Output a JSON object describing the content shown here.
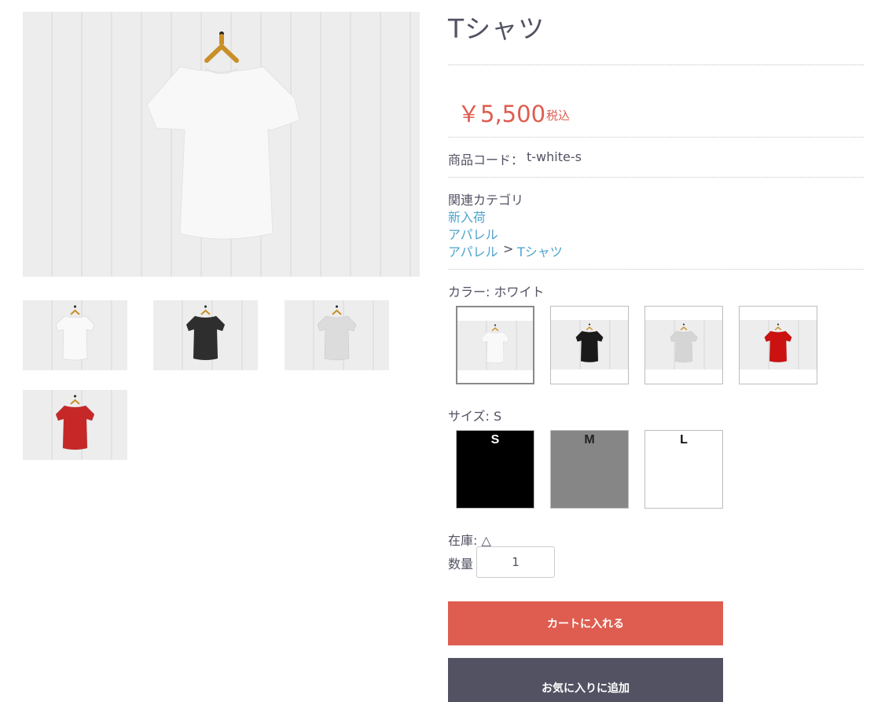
{
  "product": {
    "title": "Tシャツ",
    "price": "￥5,500",
    "tax_label": "税込",
    "code_label": "商品コード：",
    "code_value": "t-white-s"
  },
  "categories": {
    "heading": "関連カテゴリ",
    "links": [
      "新入荷",
      "アパレル",
      "アパレル"
    ],
    "separator": ">",
    "child_link": "Tシャツ"
  },
  "images": {
    "main_color": "#f8f8f8",
    "thumbnails": [
      {
        "color_name": "white",
        "hex": "#f9f9f9"
      },
      {
        "color_name": "black",
        "hex": "#2e2e2e"
      },
      {
        "color_name": "gray",
        "hex": "#dcdcdc"
      },
      {
        "color_name": "red",
        "hex": "#c62828"
      }
    ]
  },
  "color_option": {
    "label": "カラー: ホワイト",
    "swatches": [
      {
        "color_name": "white",
        "hex": "#f9f9f9",
        "selected": true
      },
      {
        "color_name": "black",
        "hex": "#1a1a1a",
        "selected": false
      },
      {
        "color_name": "gray",
        "hex": "#d5d5d5",
        "selected": false
      },
      {
        "color_name": "red",
        "hex": "#cc1111",
        "selected": false
      }
    ]
  },
  "size_option": {
    "label": "サイズ: S",
    "sizes": [
      {
        "label": "S",
        "hex": "#000000",
        "selected": true
      },
      {
        "label": "M",
        "hex": "#868686",
        "selected": false
      },
      {
        "label": "L",
        "hex": "#ffffff",
        "selected": false
      }
    ]
  },
  "stock": {
    "label": "在庫: △"
  },
  "quantity": {
    "label": "数量",
    "value": "1"
  },
  "actions": {
    "add_to_cart": "カートに入れる",
    "add_to_favorites": "お気に入りに追加"
  },
  "colors": {
    "accent": "#de5d50",
    "link": "#4ea4cc",
    "text": "#525263",
    "secondary_button": "#525263"
  }
}
